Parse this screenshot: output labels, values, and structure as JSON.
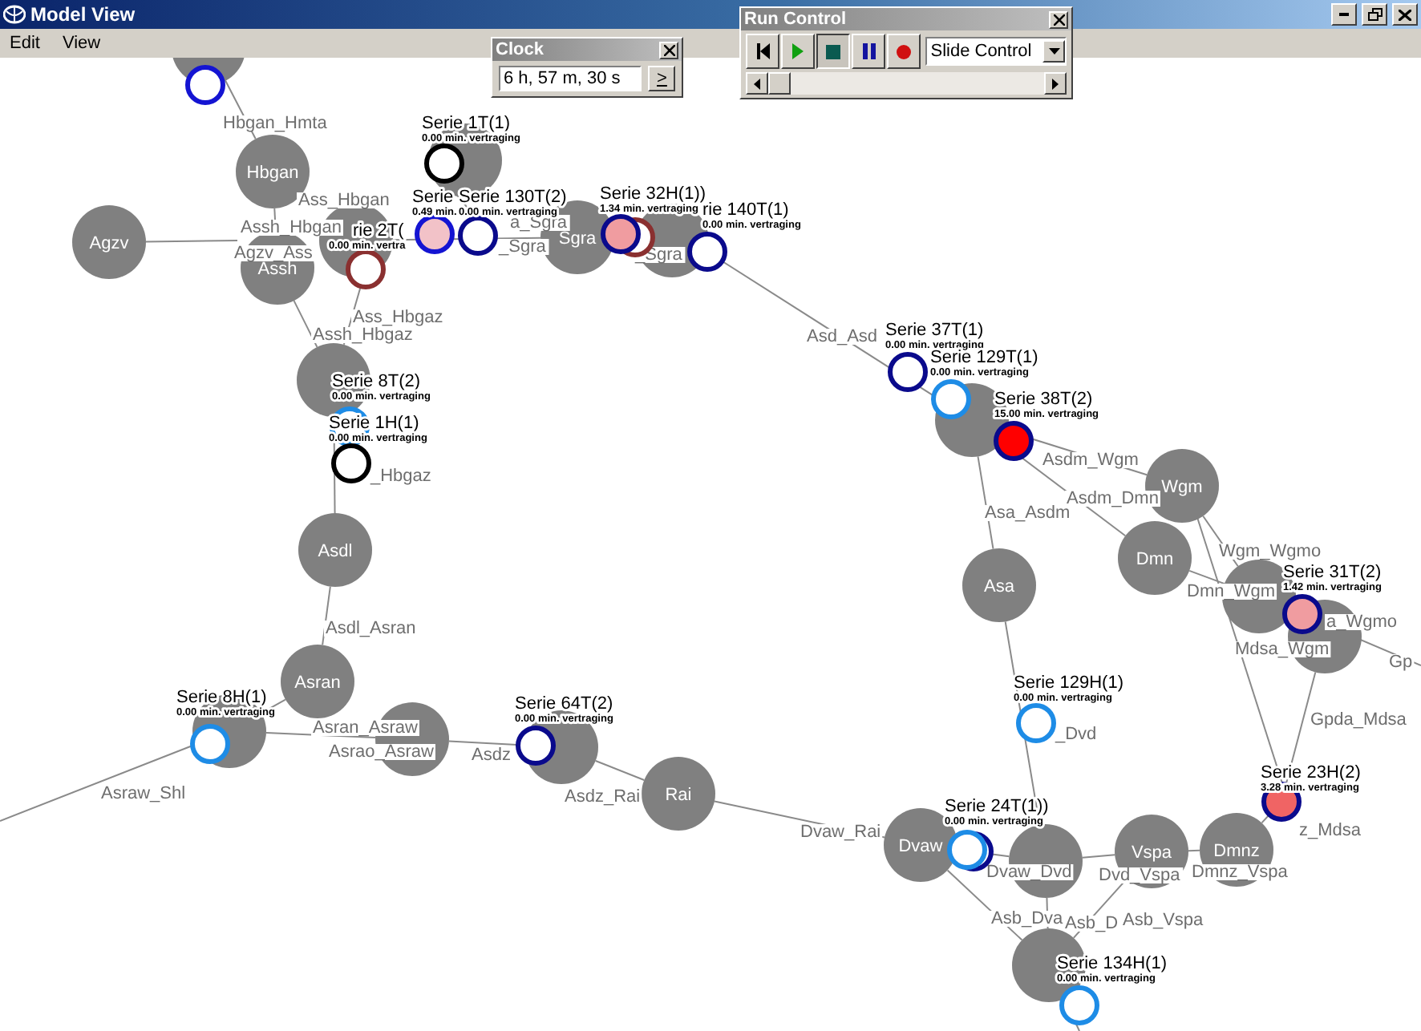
{
  "window": {
    "title": "Model View"
  },
  "menu": [
    {
      "label": "Edit"
    },
    {
      "label": "View"
    }
  ],
  "clock": {
    "title": "Clock",
    "time": "6 h, 57 m, 30 s",
    "button": ">"
  },
  "run_control": {
    "title": "Run Control",
    "buttons": [
      {
        "kind": "rewind",
        "selected": false
      },
      {
        "kind": "play",
        "selected": false
      },
      {
        "kind": "stop",
        "selected": true
      },
      {
        "kind": "pause",
        "selected": false
      },
      {
        "kind": "record",
        "selected": false
      }
    ],
    "mode": "Slide Control",
    "slider": {
      "level": 0
    }
  },
  "network": {
    "stations": [
      {
        "name": "Hbgan"
      },
      {
        "name": "Agzv"
      },
      {
        "name": "Assh"
      },
      {
        "name": "Sgra"
      },
      {
        "name": "Asdl"
      },
      {
        "name": "Asran"
      },
      {
        "name": "Rai"
      },
      {
        "name": "Wgm"
      },
      {
        "name": "Dmn"
      },
      {
        "name": "Asa"
      },
      {
        "name": "Dvaw"
      },
      {
        "name": "Vspa"
      },
      {
        "name": "Dmnz"
      }
    ],
    "links": [
      "Hbgan_Hmta",
      "Ass_Hbgan",
      "Assh_Hbgan",
      "Agzv_Ass",
      "Ass_Hbgaz",
      "Assh_Hbgaz",
      "_Hbgaz",
      "Asdl_Asran",
      "Asran_Asraw",
      "Asrao_Asraw",
      "Asraw_Shl",
      "Asdz",
      "Asdz_Rai",
      "Dvaw_Rai",
      "a_Sgra",
      "_Sgra",
      "_Sgra",
      "Asd_Asd",
      "Asdm_Wgm",
      "Asdm_Dmn",
      "Asa_Asdm",
      "Wgm_Wgmo",
      "Dmn_Wgm",
      "Mdsa_Wgm",
      "a_Wgmo",
      "Gp",
      "Gpda_Mdsa",
      "_Dvd",
      "Dvaw_Dvd",
      "Dvd_Vspa",
      "Dmnz_Vspa",
      "z_Mdsa",
      "Asb_Dva",
      "Asb_D",
      "Asb_Vspa"
    ],
    "trains": [
      {
        "color": "#1414d2",
        "kind": "none"
      },
      {
        "name": "Serie 1T(1)",
        "delay": "0.00 min. vertraging",
        "color": "#000000",
        "kind": "none"
      },
      {
        "name": "Serie",
        "delay": "0.49 min.",
        "color": "#1414d2",
        "kind": "slight"
      },
      {
        "name": "Serie 130T(2)",
        "delay": "0.00 min. vertraging",
        "color": "#0a0a8c",
        "kind": "none"
      },
      {
        "name": "rie 2T(",
        "delay": "0.00 min. vertra",
        "color": "#8a3030",
        "kind": "none"
      },
      {
        "color": "#8a3030",
        "kind": "none"
      },
      {
        "name": "Serie 32H(1))",
        "delay": "1.34 min. vertraging",
        "color": "#0a0a8c",
        "kind": "moderate"
      },
      {
        "name": "rie 140T(1)",
        "delay": "0.00 min. vertraging",
        "color": "#0a0a8c",
        "kind": "none"
      },
      {
        "name": "Serie 8T(2)",
        "delay": "0.00 min. vertraging",
        "color": "#1e8ce6",
        "kind": "none"
      },
      {
        "name": "Serie 1H(1)",
        "delay": "0.00 min. vertraging",
        "color": "#000000",
        "kind": "none"
      },
      {
        "name": "Serie 37T(1)",
        "delay": "0.00 min. vertraging",
        "color": "#0a0a8c",
        "kind": "none"
      },
      {
        "name": "Serie 129T(1)",
        "delay": "0.00 min. vertraging",
        "color": "#1e8ce6",
        "kind": "none"
      },
      {
        "name": "Serie 38T(2)",
        "delay": "15.00 min. vertraging",
        "color": "#0a0a8c",
        "kind": "severe"
      },
      {
        "name": "Serie 31T(2)",
        "delay": "1.42 min. vertraging",
        "color": "#0a0a8c",
        "kind": "moderate"
      },
      {
        "name": "Serie 129H(1)",
        "delay": "0.00 min. vertraging",
        "color": "#1e8ce6",
        "kind": "none"
      },
      {
        "name": "Serie 8H(1)",
        "delay": "0.00 min. vertraging",
        "color": "#1e8ce6",
        "kind": "none"
      },
      {
        "name": "Serie 64T(2)",
        "delay": "0.00 min. vertraging",
        "color": "#0a0a8c",
        "kind": "none"
      },
      {
        "color": "#0a0a8c",
        "kind": "none"
      },
      {
        "name": "Serie 24T(1))",
        "delay": "0.00 min. vertraging",
        "color": "#1e8ce6",
        "kind": "none"
      },
      {
        "name": "Serie 23H(2)",
        "delay": "3.28 min. vertraging",
        "color": "#0a0a8c",
        "kind": "high"
      },
      {
        "name": "Serie 134H(1)",
        "delay": "0.00 min. vertraging",
        "color": "#1e8ce6",
        "kind": "none"
      }
    ]
  }
}
